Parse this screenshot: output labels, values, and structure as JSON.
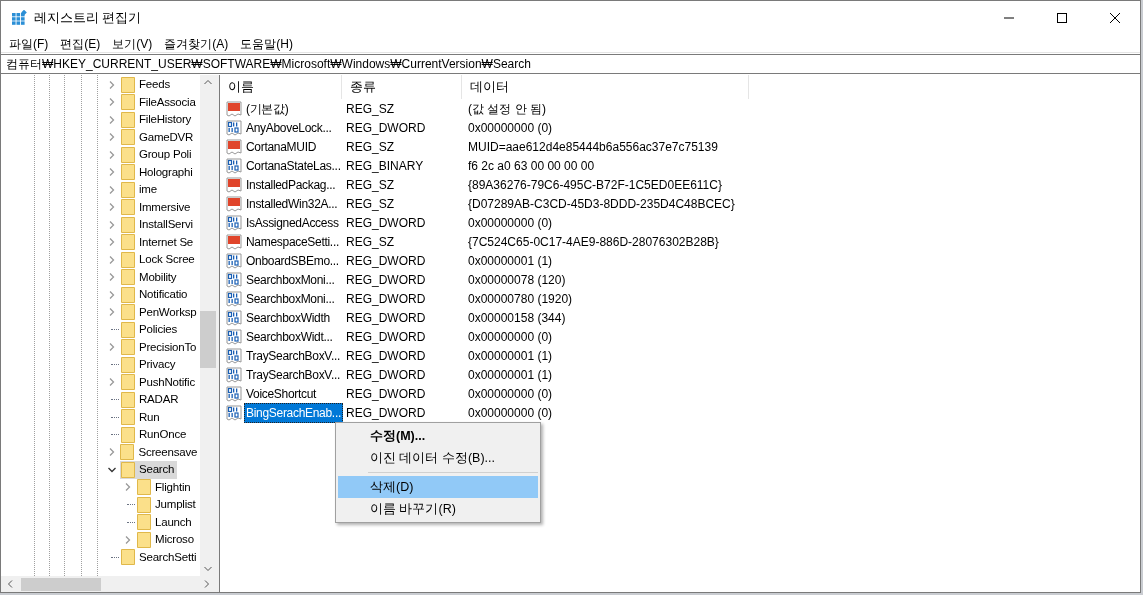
{
  "window": {
    "title": "레지스트리 편집기"
  },
  "menu": [
    "파일(F)",
    "편집(E)",
    "보기(V)",
    "즐겨찾기(A)",
    "도움말(H)"
  ],
  "address": "컴퓨터₩HKEY_CURRENT_USER₩SOFTWARE₩Microsoft₩Windows₩CurrentVersion₩Search",
  "tree": [
    {
      "label": "Feeds",
      "expandable": true,
      "expanded": false,
      "selected": false
    },
    {
      "label": "FileAssocia",
      "expandable": true,
      "expanded": false,
      "selected": false
    },
    {
      "label": "FileHistory",
      "expandable": true,
      "expanded": false,
      "selected": false
    },
    {
      "label": "GameDVR",
      "expandable": true,
      "expanded": false,
      "selected": false
    },
    {
      "label": "Group Poli",
      "expandable": true,
      "expanded": false,
      "selected": false
    },
    {
      "label": "Holographi",
      "expandable": true,
      "expanded": false,
      "selected": false
    },
    {
      "label": "ime",
      "expandable": true,
      "expanded": false,
      "selected": false
    },
    {
      "label": "Immersive",
      "expandable": true,
      "expanded": false,
      "selected": false
    },
    {
      "label": "InstallServi",
      "expandable": true,
      "expanded": false,
      "selected": false
    },
    {
      "label": "Internet Se",
      "expandable": true,
      "expanded": false,
      "selected": false
    },
    {
      "label": "Lock Scree",
      "expandable": true,
      "expanded": false,
      "selected": false
    },
    {
      "label": "Mobility",
      "expandable": true,
      "expanded": false,
      "selected": false
    },
    {
      "label": "Notificatio",
      "expandable": true,
      "expanded": false,
      "selected": false
    },
    {
      "label": "PenWorksp",
      "expandable": true,
      "expanded": false,
      "selected": false
    },
    {
      "label": "Policies",
      "expandable": false,
      "selected": false
    },
    {
      "label": "PrecisionTo",
      "expandable": true,
      "expanded": false,
      "selected": false
    },
    {
      "label": "Privacy",
      "expandable": false,
      "selected": false
    },
    {
      "label": "PushNotific",
      "expandable": true,
      "expanded": false,
      "selected": false
    },
    {
      "label": "RADAR",
      "expandable": false,
      "selected": false
    },
    {
      "label": "Run",
      "expandable": false,
      "selected": false
    },
    {
      "label": "RunOnce",
      "expandable": false,
      "selected": false
    },
    {
      "label": "Screensave",
      "expandable": true,
      "expanded": false,
      "selected": false
    },
    {
      "label": "Search",
      "expandable": true,
      "expanded": true,
      "selected": true,
      "children": [
        {
          "label": "Flightin",
          "expandable": true,
          "expanded": false,
          "selected": false
        },
        {
          "label": "Jumplist",
          "expandable": false,
          "selected": false
        },
        {
          "label": "Launch",
          "expandable": false,
          "selected": false
        },
        {
          "label": "Microso",
          "expandable": true,
          "expanded": false,
          "selected": false
        }
      ]
    },
    {
      "label": "SearchSetti",
      "expandable": false,
      "selected": false
    }
  ],
  "table": {
    "columns": [
      "이름",
      "종류",
      "데이터"
    ],
    "rows": [
      {
        "kind": "string",
        "name": "(기본값)",
        "type": "REG_SZ",
        "data": "(값 설정 안 됨)",
        "selected": false
      },
      {
        "kind": "binary",
        "name": "AnyAboveLock...",
        "type": "REG_DWORD",
        "data": "0x00000000 (0)",
        "selected": false
      },
      {
        "kind": "string",
        "name": "CortanaMUID",
        "type": "REG_SZ",
        "data": "MUID=aae612d4e85444b6a556ac37e7c75139",
        "selected": false
      },
      {
        "kind": "binary",
        "name": "CortanaStateLas...",
        "type": "REG_BINARY",
        "data": "f6 2c a0 63 00 00 00 00",
        "selected": false
      },
      {
        "kind": "string",
        "name": "InstalledPackag...",
        "type": "REG_SZ",
        "data": "{89A36276-79C6-495C-B72F-1C5ED0EE611C}",
        "selected": false
      },
      {
        "kind": "string",
        "name": "InstalledWin32A...",
        "type": "REG_SZ",
        "data": "{D07289AB-C3CD-45D3-8DDD-235D4C48BCEC}",
        "selected": false
      },
      {
        "kind": "binary",
        "name": "IsAssignedAccess",
        "type": "REG_DWORD",
        "data": "0x00000000 (0)",
        "selected": false
      },
      {
        "kind": "string",
        "name": "NamespaceSetti...",
        "type": "REG_SZ",
        "data": "{7C524C65-0C17-4AE9-886D-28076302B28B}",
        "selected": false
      },
      {
        "kind": "binary",
        "name": "OnboardSBEmo...",
        "type": "REG_DWORD",
        "data": "0x00000001 (1)",
        "selected": false
      },
      {
        "kind": "binary",
        "name": "SearchboxMoni...",
        "type": "REG_DWORD",
        "data": "0x00000078 (120)",
        "selected": false
      },
      {
        "kind": "binary",
        "name": "SearchboxMoni...",
        "type": "REG_DWORD",
        "data": "0x00000780 (1920)",
        "selected": false
      },
      {
        "kind": "binary",
        "name": "SearchboxWidth",
        "type": "REG_DWORD",
        "data": "0x00000158 (344)",
        "selected": false
      },
      {
        "kind": "binary",
        "name": "SearchboxWidt...",
        "type": "REG_DWORD",
        "data": "0x00000000 (0)",
        "selected": false
      },
      {
        "kind": "binary",
        "name": "TraySearchBoxV...",
        "type": "REG_DWORD",
        "data": "0x00000001 (1)",
        "selected": false
      },
      {
        "kind": "binary",
        "name": "TraySearchBoxV...",
        "type": "REG_DWORD",
        "data": "0x00000001 (1)",
        "selected": false
      },
      {
        "kind": "binary",
        "name": "VoiceShortcut",
        "type": "REG_DWORD",
        "data": "0x00000000 (0)",
        "selected": false
      },
      {
        "kind": "binary",
        "name": "BingSerachEnab...",
        "type": "REG_DWORD",
        "data": "0x00000000 (0)",
        "selected": true
      }
    ]
  },
  "context_menu": [
    {
      "kind": "item",
      "label": "수정(M)...",
      "default": true,
      "selected": false
    },
    {
      "kind": "item",
      "label": "이진 데이터 수정(B)...",
      "default": false,
      "selected": false
    },
    {
      "kind": "separator"
    },
    {
      "kind": "item",
      "label": "삭제(D)",
      "default": false,
      "selected": true
    },
    {
      "kind": "item",
      "label": "이름 바꾸기(R)",
      "default": false,
      "selected": false
    }
  ]
}
